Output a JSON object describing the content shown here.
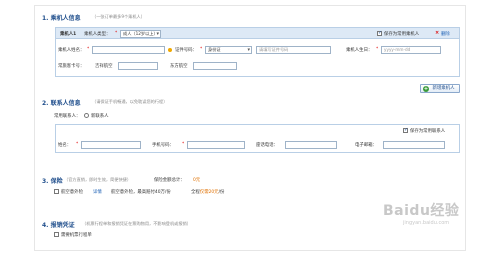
{
  "passenger_section": {
    "number": "1.",
    "title": "乘机人信息",
    "subtitle": "（一张订单最多9个乘机人）",
    "row_label": "乘机人1",
    "type_label": "乘机人类型：",
    "type_value": "成人（12岁以上）",
    "save_common_label": "保存为常用乘机人",
    "delete_label": "删除",
    "name_label": "乘机人姓名：",
    "id_label": "证件号码：",
    "id_type_value": "身份证",
    "id_number_placeholder": "请填写证件号码",
    "birthday_label": "乘机人生日：",
    "birthday_placeholder": "yyyy-mm-dd",
    "ff_label": "常旅客卡号：",
    "ff_airline": "吉祥航空",
    "ff_airline2": "东方航空",
    "add_button": "新增乘机人"
  },
  "contact_section": {
    "number": "2.",
    "title": "联系人信息",
    "subtitle": "（请保证手机畅通，以免耽误您的行程）",
    "common_label": "常用联系人：",
    "new_contact_label": "新联系人",
    "save_common_label": "保存为常用联系人",
    "name_label": "姓名：",
    "phone_label": "手机号码：",
    "landline_label": "座话电话：",
    "email_label": "电子邮箱："
  },
  "insurance_section": {
    "number": "3.",
    "title": "保险",
    "subtitle": "（官方直销，即时生效，简便快捷）",
    "total_label": "保险金额总计：",
    "total_value": "0元",
    "item_label": "航空意外险",
    "detail_link": "详情",
    "item_desc": "航空意外险，最高赔付40万/份",
    "price_prefix": "全程",
    "price_value": "仅需20元",
    "price_suffix": "/份"
  },
  "invoice_section": {
    "number": "4.",
    "title": "报销凭证",
    "subtitle": "（机票行程单和报销凭证在票购物用，不影响登机或报销）",
    "need_label": "需要机票行程单"
  },
  "watermark": {
    "main": "Baidu经验",
    "sub": "jingyan.baidu.com"
  },
  "required_mark": "*",
  "colors": {
    "section_title": "#1f4e8c",
    "panel_border": "#b9cfe6",
    "panel_header": "#dde9f6",
    "required": "#e00000",
    "price": "#e07000"
  }
}
